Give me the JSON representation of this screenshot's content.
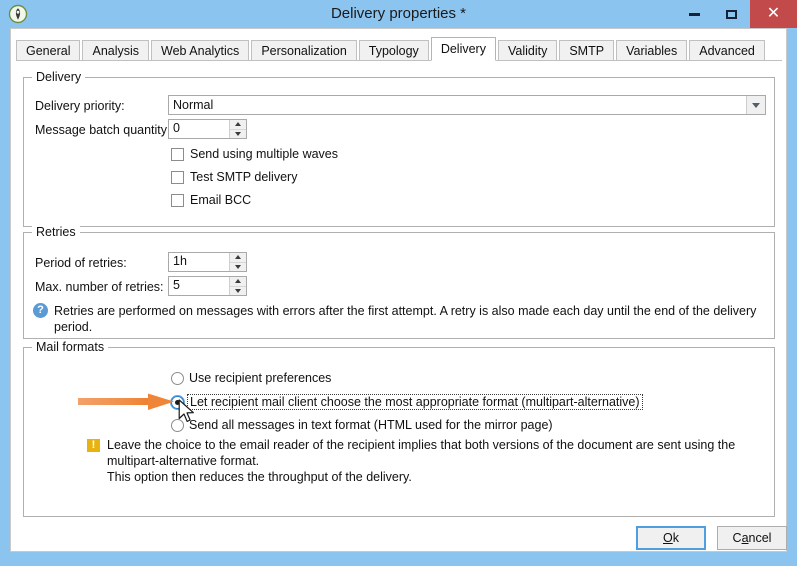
{
  "window": {
    "title": "Delivery properties *",
    "icon_name": "app-icon",
    "controls": {
      "minimize": "–",
      "maximize": "□",
      "close": "✕"
    },
    "colors": {
      "titlebar": "#8cc4f0",
      "close_button": "#c24a4a",
      "accent_focus": "#4f9ee0",
      "annotation_arrow": "#f0924e",
      "info_icon": "#5b9bd5",
      "warning_icon": "#e8b310"
    }
  },
  "tabs": [
    {
      "label": "General",
      "active": false
    },
    {
      "label": "Analysis",
      "active": false
    },
    {
      "label": "Web Analytics",
      "active": false
    },
    {
      "label": "Personalization",
      "active": false
    },
    {
      "label": "Typology",
      "active": false
    },
    {
      "label": "Delivery",
      "active": true
    },
    {
      "label": "Validity",
      "active": false
    },
    {
      "label": "SMTP",
      "active": false
    },
    {
      "label": "Variables",
      "active": false
    },
    {
      "label": "Advanced",
      "active": false
    }
  ],
  "delivery_group": {
    "title": "Delivery",
    "priority_label": "Delivery priority:",
    "priority_value": "Normal",
    "batch_label": "Message batch quantity:",
    "batch_value": "0",
    "checkboxes": [
      {
        "label": "Send using multiple waves",
        "checked": false
      },
      {
        "label": "Test SMTP delivery",
        "checked": false
      },
      {
        "label": "Email BCC",
        "checked": false
      }
    ]
  },
  "retries_group": {
    "title": "Retries",
    "period_label": "Period of retries:",
    "period_value": "1h",
    "max_label": "Max. number of retries:",
    "max_value": "5",
    "info_text": "Retries are performed on messages with errors after the first attempt. A retry is also made each day until the end of the delivery period.",
    "info_icon": "question-icon"
  },
  "mail_formats_group": {
    "title": "Mail formats",
    "options": [
      {
        "label": "Use recipient preferences",
        "selected": false,
        "focused": false
      },
      {
        "label": "Let recipient mail client choose the most appropriate format (multipart-alternative)",
        "selected": true,
        "focused": true
      },
      {
        "label": "Send all messages in text format (HTML used for the mirror page)",
        "selected": false,
        "focused": false
      }
    ],
    "warning_icon": "warning-icon",
    "warning_lines": [
      "Leave the choice to the email reader of the recipient implies that both versions of the document are sent using the",
      "multipart-alternative format.",
      "This option then reduces the throughput of the delivery."
    ]
  },
  "footer": {
    "ok_label_pre": "O",
    "ok_label_post": "k",
    "cancel_label_pre": "C",
    "cancel_label_mid": "a",
    "cancel_label_post": "ncel"
  }
}
